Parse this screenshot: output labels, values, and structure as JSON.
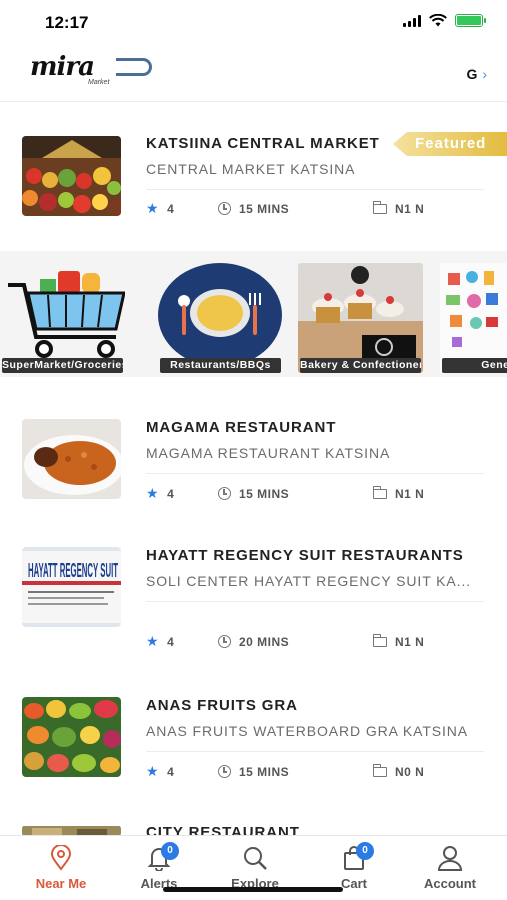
{
  "status_bar": {
    "time": "12:17"
  },
  "header": {
    "logo_text": "mira",
    "logo_sub": "Market",
    "language": "G"
  },
  "listings": [
    {
      "title": "KATSIINA CENTRAL MARKET",
      "subtitle": "CENTRAL MARKET KATSINA",
      "rating": "4",
      "time": "15 MINS",
      "fee": "N1 N",
      "badge": "Featured"
    },
    {
      "title": "MAGAMA RESTAURANT",
      "subtitle": "MAGAMA RESTAURANT KATSINA",
      "rating": "4",
      "time": "15 MINS",
      "fee": "N1 N"
    },
    {
      "title": "HAYATT REGENCY SUIT RESTAURANTS",
      "subtitle": "SOLI CENTER HAYATT REGENCY SUIT KA...",
      "rating": "4",
      "time": "20 MINS",
      "fee": "N1 N",
      "image_text": "HAYATT REGENCY SUIT"
    },
    {
      "title": "ANAS FRUITS GRA",
      "subtitle": "ANAS FRUITS WATERBOARD GRA KATSINA",
      "rating": "4",
      "time": "15 MINS",
      "fee": "N0 N"
    },
    {
      "title": "CITY RESTAURANT"
    }
  ],
  "categories": [
    {
      "label": "SuperMarket/Groceries"
    },
    {
      "label": "Restaurants/BBQs"
    },
    {
      "label": "Bakery & Confectionery"
    },
    {
      "label": "General"
    }
  ],
  "tabbar": {
    "near_me": "Near Me",
    "alerts": "Alerts",
    "alerts_badge": "0",
    "explore": "Explore",
    "cart": "Cart",
    "cart_badge": "0",
    "account": "Account"
  },
  "colors": {
    "accent": "#d85a3a",
    "badge_blue": "#2c7be5",
    "featured_gold": "#e3bb3f"
  }
}
